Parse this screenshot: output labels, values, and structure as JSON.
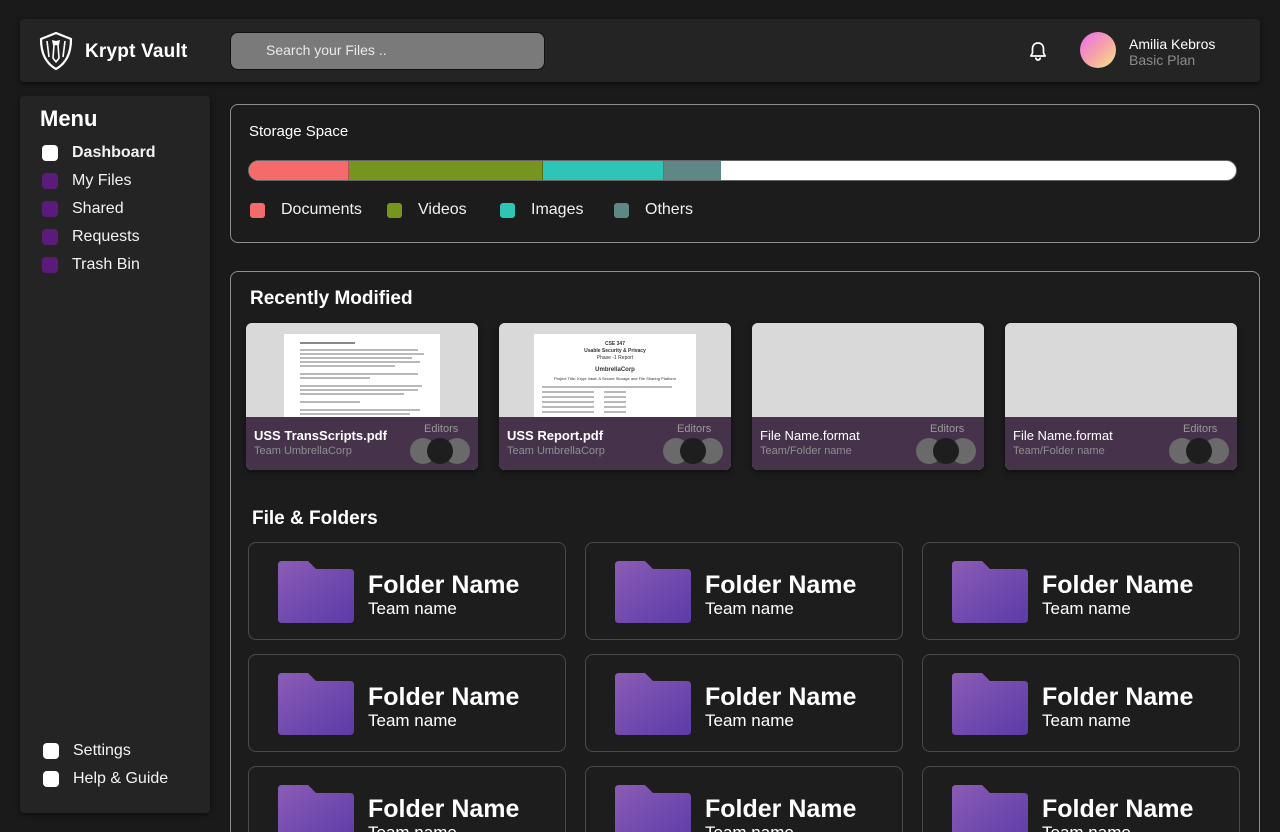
{
  "app": {
    "brand": "Krypt Vault",
    "search_placeholder": "Search your Files ..",
    "user": {
      "name": "Amilia Kebros",
      "plan": "Basic Plan"
    }
  },
  "sidebar": {
    "title": "Menu",
    "items": [
      {
        "label": "Dashboard",
        "active": true
      },
      {
        "label": "My Files"
      },
      {
        "label": "Shared"
      },
      {
        "label": "Requests"
      },
      {
        "label": "Trash Bin"
      }
    ],
    "bottom": [
      {
        "label": "Settings"
      },
      {
        "label": "Help & Guide"
      }
    ]
  },
  "storage": {
    "title": "Storage Space",
    "segments": [
      {
        "label": "Documents",
        "color": "#f56b6b",
        "fraction": 0.101
      },
      {
        "label": "Videos",
        "color": "#76951f",
        "fraction": 0.197
      },
      {
        "label": "Images",
        "color": "#2ec4b6",
        "fraction": 0.122
      },
      {
        "label": "Others",
        "color": "#5f8786",
        "fraction": 0.058
      }
    ]
  },
  "recent": {
    "title": "Recently Modified",
    "cards": [
      {
        "name": "USS TransScripts.pdf",
        "team": "Team UmbrellaCorp",
        "editors_label": "Editors",
        "preview": "transcript"
      },
      {
        "name": "USS Report.pdf",
        "team": "Team UmbrellaCorp",
        "editors_label": "Editors",
        "preview": "report"
      },
      {
        "name": "File Name.format",
        "team": "Team/Folder name",
        "editors_label": "Editors",
        "preview": "none"
      },
      {
        "name": "File Name.format",
        "team": "Team/Folder name",
        "editors_label": "Editors",
        "preview": "none"
      }
    ],
    "report_preview": {
      "course": "CSE 347",
      "subject": "Usable Security & Privacy",
      "phase": "Phase -1 Report",
      "corp": "UmbrellaCorp",
      "project": "Project Title: Krypt Vault: A Secure Storage and File Sharing Platform"
    }
  },
  "folders": {
    "title": "File & Folders",
    "items": [
      {
        "name": "Folder Name",
        "team": "Team name"
      },
      {
        "name": "Folder Name",
        "team": "Team name"
      },
      {
        "name": "Folder Name",
        "team": "Team name"
      },
      {
        "name": "Folder Name",
        "team": "Team name"
      },
      {
        "name": "Folder Name",
        "team": "Team name"
      },
      {
        "name": "Folder Name",
        "team": "Team name"
      },
      {
        "name": "Folder Name",
        "team": "Team name"
      },
      {
        "name": "Folder Name",
        "team": "Team name"
      },
      {
        "name": "Folder Name",
        "team": "Team name"
      }
    ]
  },
  "colors": {
    "nav_dot": "#5b1b7a",
    "nav_dot_active": "#ffffff",
    "card_footer": "#46324b",
    "folder_top": "#8a5cb5",
    "folder_bottom": "#5b3aa8"
  }
}
